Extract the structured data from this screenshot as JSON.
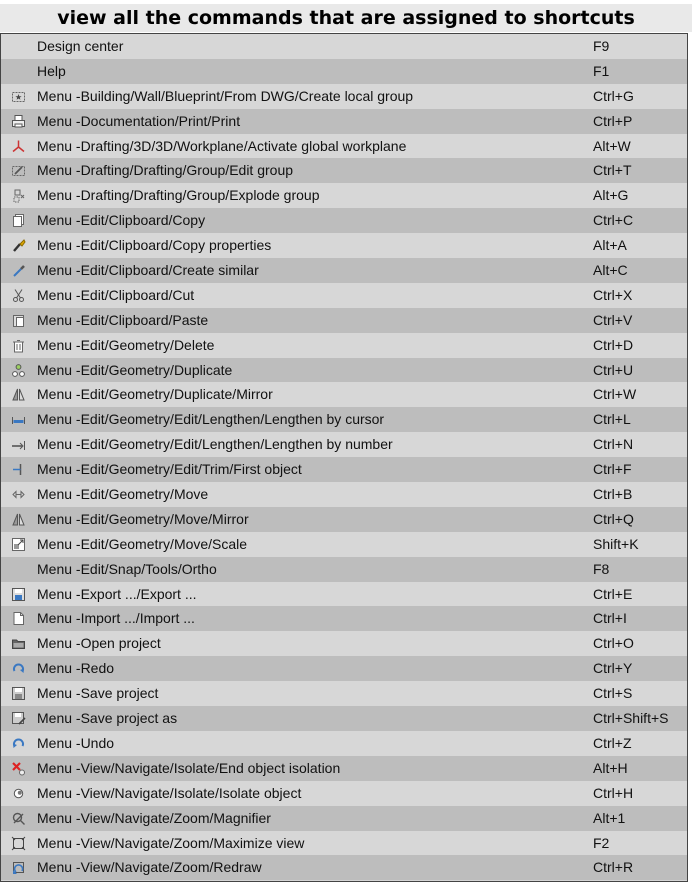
{
  "title": "view all the commands that are assigned to shortcuts",
  "rows": [
    {
      "command": "Design center",
      "shortcut": "F9",
      "icon": ""
    },
    {
      "command": "Help",
      "shortcut": "F1",
      "icon": ""
    },
    {
      "command": "Menu -Building/Wall/Blueprint/From DWG/Create local group",
      "shortcut": "Ctrl+G",
      "icon": "local-group-icon"
    },
    {
      "command": "Menu -Documentation/Print/Print",
      "shortcut": "Ctrl+P",
      "icon": "printer-icon"
    },
    {
      "command": "Menu -Drafting/3D/3D/Workplane/Activate global workplane",
      "shortcut": "Alt+W",
      "icon": "workplane-axes-icon"
    },
    {
      "command": "Menu -Drafting/Drafting/Group/Edit group",
      "shortcut": "Ctrl+T",
      "icon": "edit-group-icon"
    },
    {
      "command": "Menu -Drafting/Drafting/Group/Explode group",
      "shortcut": "Alt+G",
      "icon": "explode-group-icon"
    },
    {
      "command": "Menu -Edit/Clipboard/Copy",
      "shortcut": "Ctrl+C",
      "icon": "copy-icon"
    },
    {
      "command": "Menu -Edit/Clipboard/Copy properties",
      "shortcut": "Alt+A",
      "icon": "brush-icon"
    },
    {
      "command": "Menu -Edit/Clipboard/Create similar",
      "shortcut": "Alt+C",
      "icon": "eyedropper-icon"
    },
    {
      "command": "Menu -Edit/Clipboard/Cut",
      "shortcut": "Ctrl+X",
      "icon": "scissors-icon"
    },
    {
      "command": "Menu -Edit/Clipboard/Paste",
      "shortcut": "Ctrl+V",
      "icon": "paste-icon"
    },
    {
      "command": "Menu -Edit/Geometry/Delete",
      "shortcut": "Ctrl+D",
      "icon": "trash-icon"
    },
    {
      "command": "Menu -Edit/Geometry/Duplicate",
      "shortcut": "Ctrl+U",
      "icon": "duplicate-icon"
    },
    {
      "command": "Menu -Edit/Geometry/Duplicate/Mirror",
      "shortcut": "Ctrl+W",
      "icon": "mirror-icon"
    },
    {
      "command": "Menu -Edit/Geometry/Edit/Lengthen/Lengthen by cursor",
      "shortcut": "Ctrl+L",
      "icon": "lengthen-cursor-icon"
    },
    {
      "command": "Menu -Edit/Geometry/Edit/Lengthen/Lengthen by number",
      "shortcut": "Ctrl+N",
      "icon": "lengthen-number-icon"
    },
    {
      "command": "Menu -Edit/Geometry/Edit/Trim/First object",
      "shortcut": "Ctrl+F",
      "icon": "trim-icon"
    },
    {
      "command": "Menu -Edit/Geometry/Move",
      "shortcut": "Ctrl+B",
      "icon": "move-icon"
    },
    {
      "command": "Menu -Edit/Geometry/Move/Mirror",
      "shortcut": "Ctrl+Q",
      "icon": "mirror-icon"
    },
    {
      "command": "Menu -Edit/Geometry/Move/Scale",
      "shortcut": "Shift+K",
      "icon": "scale-icon"
    },
    {
      "command": "Menu -Edit/Snap/Tools/Ortho",
      "shortcut": "F8",
      "icon": ""
    },
    {
      "command": "Menu -Export .../Export ...",
      "shortcut": "Ctrl+E",
      "icon": "export-icon"
    },
    {
      "command": "Menu -Import .../Import ...",
      "shortcut": "Ctrl+I",
      "icon": "import-icon"
    },
    {
      "command": "Menu -Open project",
      "shortcut": "Ctrl+O",
      "icon": "folder-icon"
    },
    {
      "command": "Menu -Redo",
      "shortcut": "Ctrl+Y",
      "icon": "redo-icon"
    },
    {
      "command": "Menu -Save project",
      "shortcut": "Ctrl+S",
      "icon": "save-icon"
    },
    {
      "command": "Menu -Save project as",
      "shortcut": "Ctrl+Shift+S",
      "icon": "save-as-icon"
    },
    {
      "command": "Menu -Undo",
      "shortcut": "Ctrl+Z",
      "icon": "undo-icon"
    },
    {
      "command": "Menu -View/Navigate/Isolate/End object isolation",
      "shortcut": "Alt+H",
      "icon": "end-isolation-icon"
    },
    {
      "command": "Menu -View/Navigate/Isolate/Isolate object",
      "shortcut": "Ctrl+H",
      "icon": "isolate-icon"
    },
    {
      "command": "Menu -View/Navigate/Zoom/Magnifier",
      "shortcut": "Alt+1",
      "icon": "magnifier-icon"
    },
    {
      "command": "Menu -View/Navigate/Zoom/Maximize view",
      "shortcut": "F2",
      "icon": "maximize-icon"
    },
    {
      "command": "Menu -View/Navigate/Zoom/Redraw",
      "shortcut": "Ctrl+R",
      "icon": "redraw-icon"
    }
  ]
}
